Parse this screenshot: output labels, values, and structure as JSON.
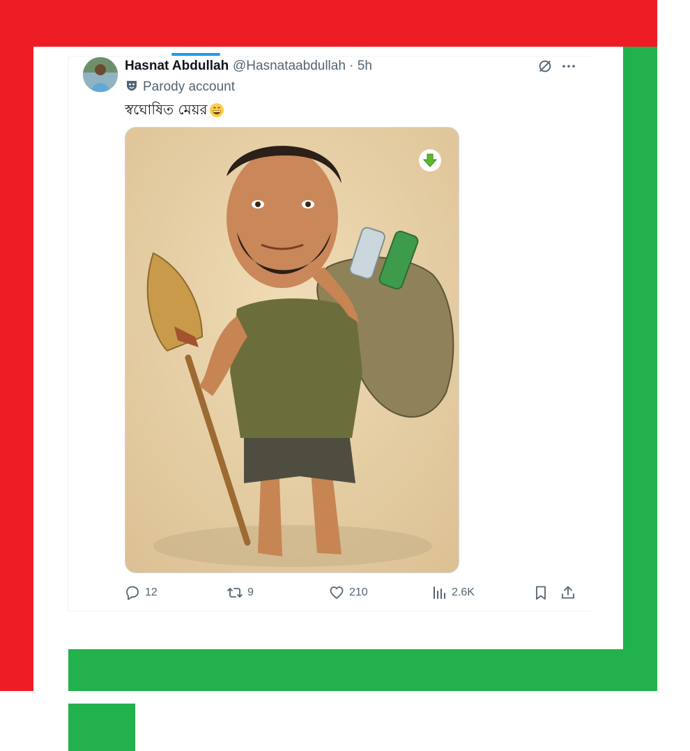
{
  "tweet": {
    "author_name": "Hasnat Abdullah",
    "handle_time": "@Hasnataabdullah · 5h",
    "badge_label": "Parody account",
    "text": "স্বঘোষিত মেয়র",
    "emoji_icon": "grinning-face-emoji",
    "media_alt": "caricature illustration of man with broom and sack of plastic bottles"
  },
  "actions": {
    "replies": "12",
    "retweets": "9",
    "likes": "210",
    "views": "2.6K"
  },
  "colors": {
    "frame_red": "#ee1c25",
    "frame_green": "#22b14c",
    "accent_blue": "#1d9bf0",
    "secondary_text": "#536471"
  }
}
